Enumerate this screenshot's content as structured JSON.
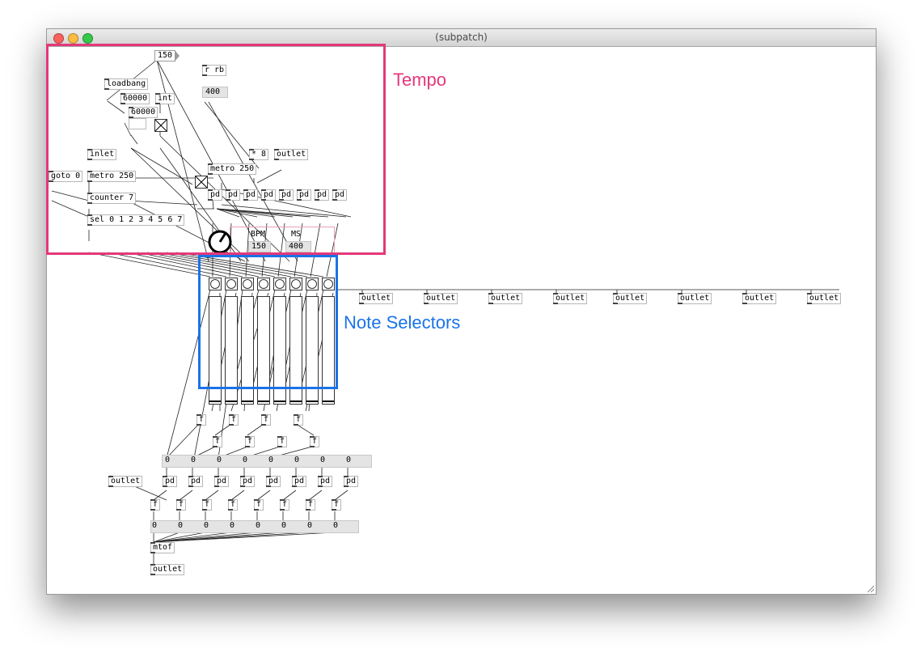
{
  "window": {
    "title": "(subpatch)"
  },
  "annotations": {
    "tempo": {
      "text": "Tempo",
      "color": "#e4387a"
    },
    "notes": {
      "text": "Note Selectors",
      "color": "#1a73e8"
    }
  },
  "objects": {
    "num150": "150",
    "r_rb": "r rb",
    "num400": "400",
    "loadbang": "loadbang",
    "msg60000a": "60000",
    "int": "int",
    "msg60000b": "60000",
    "inlet": "inlet",
    "mul8": "* 8",
    "outlet_top": "outlet",
    "goto0": "goto 0",
    "metro250": "metro 250",
    "metro250b": "metro 250",
    "counter7": "counter 7",
    "sel": "sel 0 1 2 3 4 5 6 7",
    "pd": "pd",
    "bpm_label": "BPM",
    "ms_label": "MS",
    "bpm_value": "150",
    "ms_value": "400",
    "f": "f",
    "zero": "0",
    "outlet": "outlet",
    "outlet_left": "outlet",
    "mtof": "mtof",
    "outlet_bottom": "outlet"
  }
}
